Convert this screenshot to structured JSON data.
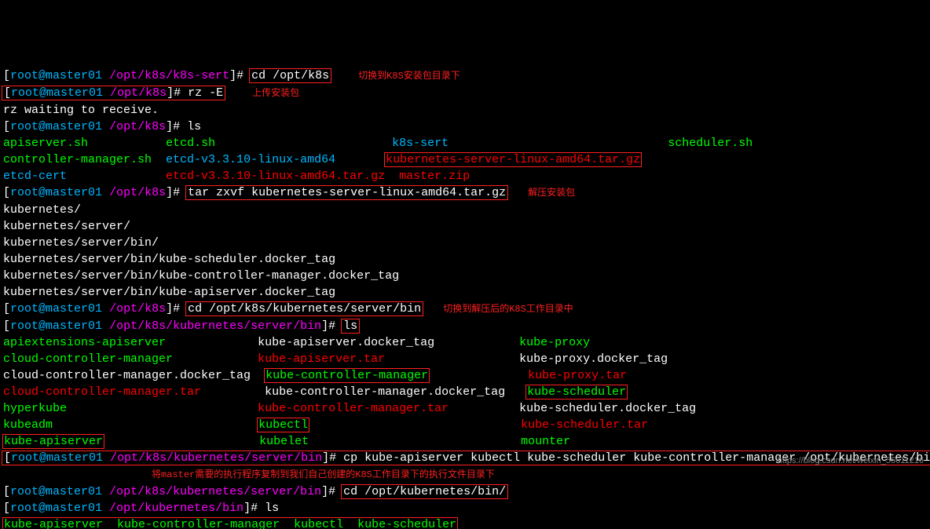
{
  "prompt": {
    "user_host": "root@master01",
    "open": "[",
    "close": "]#"
  },
  "paths": {
    "k8s_sert": "/opt/k8s/k8s-sert",
    "k8s": "/opt/k8s",
    "server_bin": "/opt/k8s/kubernetes/server/bin",
    "k8s_bin": "/opt/kubernetes/bin"
  },
  "cmds": {
    "cd_k8s": "cd /opt/k8s",
    "rz": "rz -E",
    "rz_wait": "rz waiting to receive.",
    "ls": "ls",
    "tar": "tar zxvf kubernetes-server-linux-amd64.tar.gz",
    "cd_bin": "cd /opt/k8s/kubernetes/server/bin",
    "cp": "cp kube-apiserver kubectl kube-scheduler kube-controller-manager /opt/kubernetes/bin/",
    "cd_kbin": "cd /opt/kubernetes/bin/"
  },
  "annot": {
    "a1": "切换到K8S安装包目录下",
    "a2": "上传安装包",
    "a3": "解压安装包",
    "a4": "切换到解压后的K8S工作目录中",
    "a5": "将master需要的执行程序复制到我们自己创建的K8S工作目录下的执行文件目录下"
  },
  "ls1": {
    "c11": "apiserver.sh",
    "c12": "etcd.sh",
    "c13": "k8s-sert",
    "c14": "scheduler.sh",
    "c21": "controller-manager.sh",
    "c22": "etcd-v3.3.10-linux-amd64",
    "c23": "kubernetes-server-linux-amd64.tar.gz",
    "c31": "etcd-cert",
    "c32": "etcd-v3.3.10-linux-amd64.tar.gz",
    "c33": "master.zip"
  },
  "tar_out": {
    "l1": "kubernetes/",
    "l2": "kubernetes/server/",
    "l3": "kubernetes/server/bin/",
    "l4": "kubernetes/server/bin/kube-scheduler.docker_tag",
    "l5": "kubernetes/server/bin/kube-controller-manager.docker_tag",
    "l6": "kubernetes/server/bin/kube-apiserver.docker_tag"
  },
  "grid": {
    "c1": [
      "apiextensions-apiserver",
      "cloud-controller-manager",
      "cloud-controller-manager.docker_tag",
      "cloud-controller-manager.tar",
      "hyperkube",
      "kubeadm",
      "kube-apiserver"
    ],
    "c2": [
      "kube-apiserver.docker_tag",
      "kube-apiserver.tar",
      "kube-controller-manager",
      "kube-controller-manager.docker_tag",
      "kube-controller-manager.tar",
      "kubectl",
      "kubelet"
    ],
    "c3": [
      "kube-proxy",
      "kube-proxy.docker_tag",
      "kube-proxy.tar",
      "kube-scheduler",
      "kube-scheduler.docker_tag",
      "kube-scheduler.tar",
      "mounter"
    ]
  },
  "finals": {
    "f1": "kube-apiserver",
    "f2": "kube-controller-manager",
    "f3": "kubectl",
    "f4": "kube-scheduler"
  },
  "watermark": "https://blog.csdn.net/weixin_55611216"
}
